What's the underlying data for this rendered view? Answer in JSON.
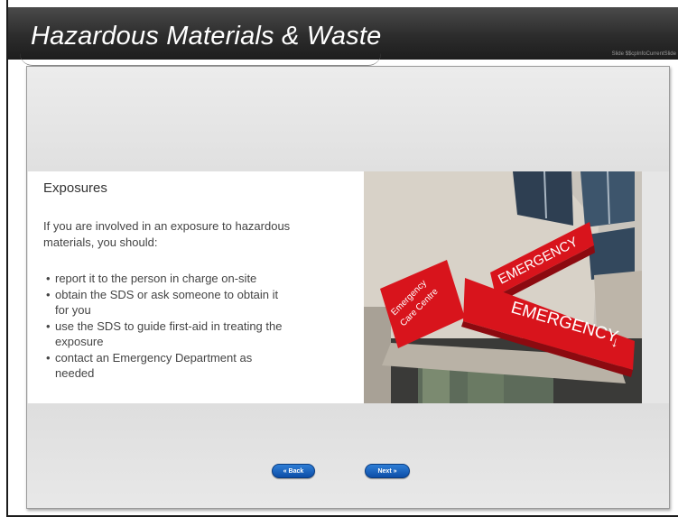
{
  "header": {
    "title": "Hazardous Materials & Waste",
    "slide_counter": "Slide $$cpInfoCurrentSlide"
  },
  "content": {
    "heading": "Exposures",
    "intro": "If you are involved in an exposure to hazardous materials, you should:",
    "bullets": [
      "report it to the person in charge on-site",
      "obtain the SDS or ask someone to obtain it for you",
      "use the SDS to guide first-aid in treating the exposure",
      "contact an Emergency Department as needed"
    ]
  },
  "photo": {
    "sign_upper": "EMERGENCY",
    "sign_lower": "EMERGENCY",
    "side_sign_line1": "Emergency",
    "side_sign_line2": "Care Centre",
    "arrow": "↓"
  },
  "nav": {
    "back_label": "« Back",
    "next_label": "Next »"
  },
  "colors": {
    "header_bg": "#2c2c2c",
    "sign_red": "#d8141c",
    "button_blue": "#1a64c0"
  }
}
